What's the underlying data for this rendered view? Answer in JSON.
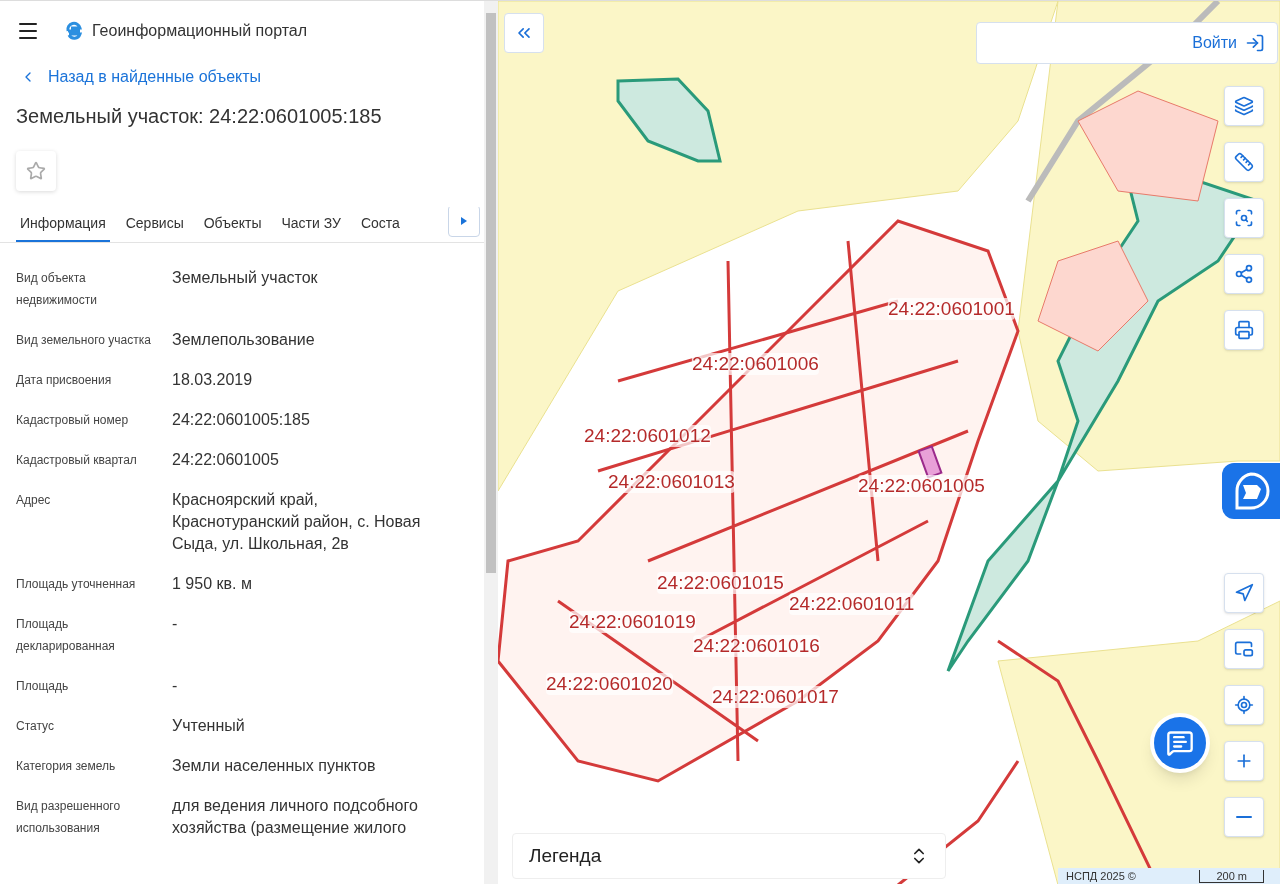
{
  "header": {
    "title": "Геоинформационный портал"
  },
  "back_link": "Назад в найденные объекты",
  "object_title": "Земельный участок: 24:22:0601005:185",
  "favorite": {
    "selected": false
  },
  "tabs": [
    {
      "label": "Информация",
      "selected": true
    },
    {
      "label": "Сервисы",
      "selected": false
    },
    {
      "label": "Объекты",
      "selected": false
    },
    {
      "label": "Части ЗУ",
      "selected": false
    },
    {
      "label": "Соста",
      "selected": false
    }
  ],
  "fields": [
    {
      "label": "Вид объекта недвижимости",
      "value": "Земельный участок"
    },
    {
      "label": "Вид земельного участка",
      "value": "Землепользование"
    },
    {
      "label": "Дата присвоения",
      "value": "18.03.2019"
    },
    {
      "label": "Кадастровый номер",
      "value": "24:22:0601005:185"
    },
    {
      "label": "Кадастровый квартал",
      "value": "24:22:0601005"
    },
    {
      "label": "Адрес",
      "value": "Красноярский край, Краснотуранский район, с. Новая Сыда, ул. Школьная, 2в"
    },
    {
      "label": "Площадь уточненная",
      "value": "1 950 кв. м"
    },
    {
      "label": "Площадь декларированная",
      "value": "-"
    },
    {
      "label": "Площадь",
      "value": "-"
    },
    {
      "label": "Статус",
      "value": "Учтенный"
    },
    {
      "label": "Категория земель",
      "value": "Земли населенных пунктов"
    },
    {
      "label": "Вид разрешенного использования",
      "value": "для ведения личного подсобного хозяйства (размещение жилого"
    }
  ],
  "map": {
    "login_button": "Войти",
    "quarter_labels": [
      "24:22:0601001",
      "24:22:0601006",
      "24:22:0601012",
      "24:22:0601013",
      "24:22:0601005",
      "24:22:0601015",
      "24:22:0601011",
      "24:22:0601019",
      "24:22:0601016",
      "24:22:0601020",
      "24:22:0601017"
    ],
    "legend": "Легенда",
    "attribution": "НСПД 2025 ©",
    "scale": "200 m"
  }
}
